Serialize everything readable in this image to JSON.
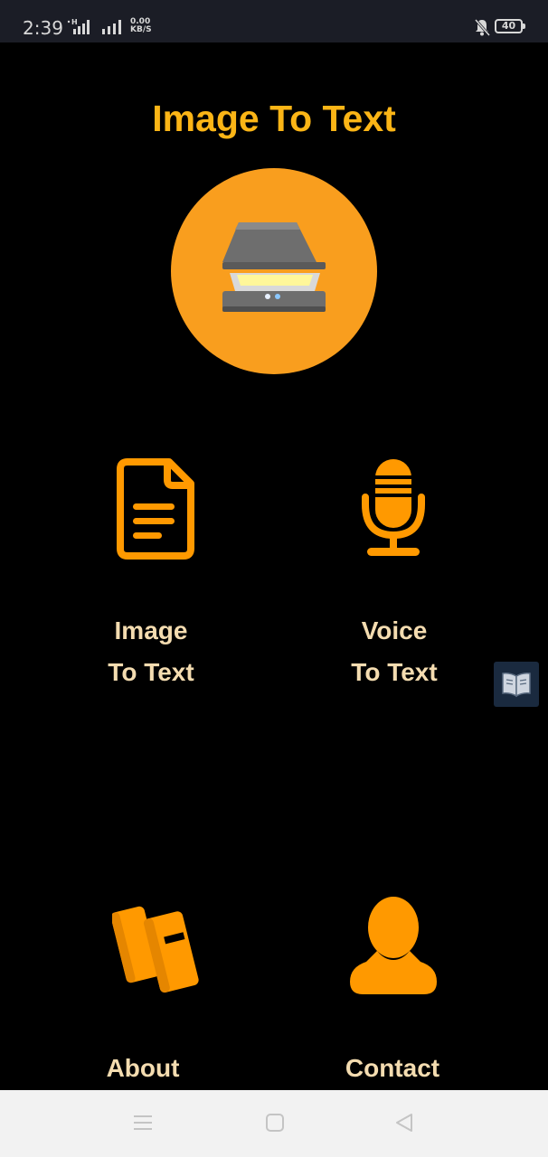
{
  "status_bar": {
    "time": "2:39",
    "network_speed_value": "0.00",
    "network_speed_unit": "KB/S",
    "battery_level": "40",
    "icons": [
      "signal-h-icon",
      "signal-icon",
      "mute-bell-icon",
      "battery-icon"
    ]
  },
  "app": {
    "title": "Image To Text",
    "hero_icon": "scanner-icon",
    "accent_color": "#fbb516",
    "circle_color": "#f99e1e",
    "icon_color": "#ff9900",
    "label_color": "#f4dcb0"
  },
  "menu": {
    "image_to_text": {
      "line1": "Image",
      "line2": "To Text",
      "icon": "document-icon"
    },
    "voice_to_text": {
      "line1": "Voice",
      "line2": "To Text",
      "icon": "microphone-icon"
    },
    "about": {
      "label": "About",
      "icon": "books-icon"
    },
    "contact": {
      "label": "Contact",
      "icon": "person-icon"
    }
  },
  "floating_button": {
    "icon": "book-icon"
  },
  "nav_bar": {
    "icons": [
      "menu-icon",
      "home-icon",
      "back-icon"
    ]
  }
}
